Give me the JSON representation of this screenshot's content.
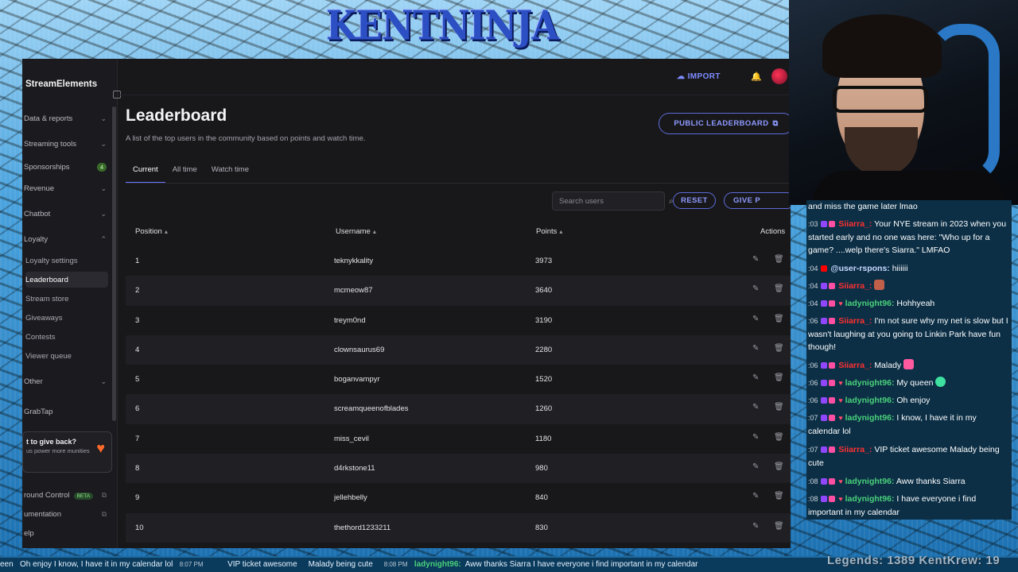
{
  "overlay": {
    "logo_text": "KENTNINJA"
  },
  "app": {
    "brand": "StreamElements",
    "topbar": {
      "import_label": "IMPORT"
    },
    "sidebar": {
      "sections": [
        {
          "label": "Data & reports",
          "chevron": "⌄"
        },
        {
          "label": "Streaming tools",
          "chevron": "⌄"
        },
        {
          "label": "Sponsorships",
          "badge": "4"
        },
        {
          "label": "Revenue",
          "chevron": "⌄"
        },
        {
          "label": "Chatbot",
          "chevron": "⌄"
        },
        {
          "label": "Loyalty",
          "chevron": "⌃"
        }
      ],
      "loyalty_items": [
        "Loyalty settings",
        "Leaderboard",
        "Stream store",
        "Giveaways",
        "Contests",
        "Viewer queue"
      ],
      "other_label": "Other",
      "other_chevron": "⌄",
      "grabtap_label": "GrabTap",
      "promo": {
        "title": "t to give back?",
        "text": "us power more munities"
      },
      "footer": [
        {
          "label": "round Control",
          "beta": "BETA"
        },
        {
          "label": "umentation"
        },
        {
          "label": "elp"
        }
      ]
    },
    "page": {
      "title": "Leaderboard",
      "subtitle": "A list of the top users in the community based on points and watch time.",
      "public_button": "PUBLIC LEADERBOARD",
      "tabs": [
        "Current",
        "All time",
        "Watch time"
      ],
      "active_tab": "Current",
      "search_placeholder": "Search users",
      "reset_label": "RESET",
      "give_label": "GIVE P",
      "columns": {
        "position": "Position",
        "username": "Username",
        "points": "Points",
        "actions": "Actions"
      },
      "rows": [
        {
          "position": "1",
          "username": "teknykkality",
          "points": "3973"
        },
        {
          "position": "2",
          "username": "mcmeow87",
          "points": "3640"
        },
        {
          "position": "3",
          "username": "treym0nd",
          "points": "3190"
        },
        {
          "position": "4",
          "username": "clownsaurus69",
          "points": "2280"
        },
        {
          "position": "5",
          "username": "boganvampyr",
          "points": "1520"
        },
        {
          "position": "6",
          "username": "screamqueenofblades",
          "points": "1260"
        },
        {
          "position": "7",
          "username": "miss_cevil",
          "points": "1180"
        },
        {
          "position": "8",
          "username": "d4rkstone11",
          "points": "980"
        },
        {
          "position": "9",
          "username": "jellehbelly",
          "points": "840"
        },
        {
          "position": "10",
          "username": "thethord1233211",
          "points": "830"
        }
      ]
    }
  },
  "chat": {
    "messages": [
      {
        "ts": "",
        "name": "",
        "text": "and miss the game later lmao"
      },
      {
        "ts": ":03",
        "name": "Siiarra_:",
        "color": "red",
        "text": "Your NYE stream in 2023 when you started early and no one was here: \"Who up for a game? ....welp there's Siarra.\" LMFAO"
      },
      {
        "ts": ":04",
        "name": "@user-rspons:",
        "color": "blue",
        "text": "hiiiiii"
      },
      {
        "ts": ":04",
        "name": "Siiarra_:",
        "color": "red",
        "text": ""
      },
      {
        "ts": ":04",
        "name": "ladynight96:",
        "color": "green",
        "text": "Hohhyeah"
      },
      {
        "ts": ":06",
        "name": "Siiarra_:",
        "color": "red",
        "text": "I'm not sure why my net is slow but I wasn't laughing at you going to Linkin Park  have fun though!"
      },
      {
        "ts": ":06",
        "name": "Siiarra_:",
        "color": "red",
        "text": "Malady"
      },
      {
        "ts": ":06",
        "name": "ladynight96:",
        "color": "green",
        "text": "My queen"
      },
      {
        "ts": ":06",
        "name": "ladynight96:",
        "color": "green",
        "text": "Oh enjoy"
      },
      {
        "ts": ":07",
        "name": "ladynight96:",
        "color": "green",
        "text": "I know, I have it in my calendar lol"
      },
      {
        "ts": ":07",
        "name": "Siiarra_:",
        "color": "red",
        "text": "VIP ticket awesome  Malady being cute"
      },
      {
        "ts": ":08",
        "name": "ladynight96:",
        "color": "green",
        "text": "Aww thanks Siarra"
      },
      {
        "ts": ":08",
        "name": "ladynight96:",
        "color": "green",
        "text": "I have everyone i find important in my calendar"
      }
    ]
  },
  "ticker": {
    "text_1": "een",
    "text_2": "Oh enjoy  I know, I have it in my calendar lol",
    "ts_1": "8:07 PM",
    "text_3": "VIP ticket awesome",
    "text_4": "Malady being cute",
    "ts_2": "8:08 PM",
    "name_1": "ladynight96:",
    "text_5": "Aww thanks Siarra  I have everyone i find important in my calendar",
    "legends": "Legends: 1389 KentKrew: 19"
  }
}
